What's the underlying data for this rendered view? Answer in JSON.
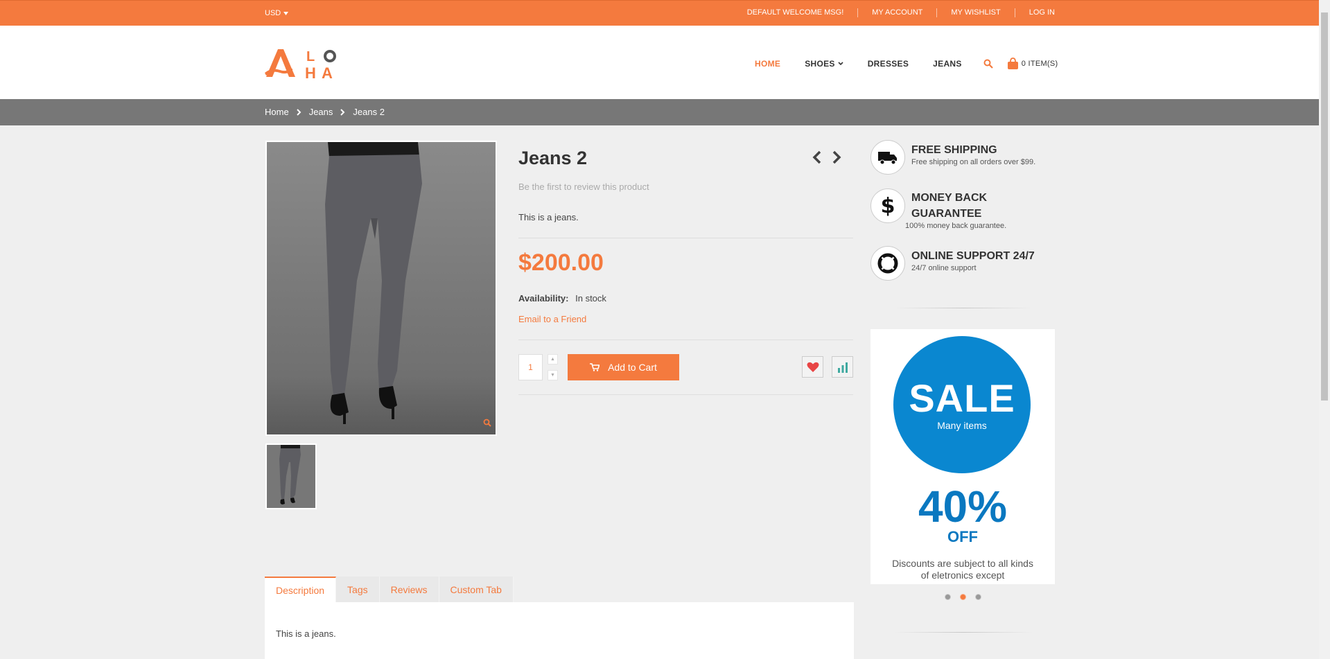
{
  "topbar": {
    "currency": "USD",
    "links": [
      "DEFAULT WELCOME MSG!",
      "MY ACCOUNT",
      "MY WISHLIST",
      "LOG IN"
    ]
  },
  "logo": {
    "letters": [
      "A",
      "L",
      "O",
      "H",
      "A"
    ],
    "alt": "ALOHA"
  },
  "nav": {
    "items": [
      "HOME",
      "SHOES",
      "DRESSES",
      "JEANS"
    ],
    "cart_label": "0 ITEM(S)"
  },
  "breadcrumb": [
    "Home",
    "Jeans",
    "Jeans 2"
  ],
  "product": {
    "name": "Jeans 2",
    "review_text": "Be the first to review this product",
    "short_description": "This is a jeans.",
    "price": "$200.00",
    "availability_label": "Availability:",
    "availability_value": "In stock",
    "email_link": "Email to a Friend",
    "qty": "1",
    "add_to_cart": "Add to Cart"
  },
  "features": [
    {
      "title": "FREE SHIPPING",
      "subtitle": "Free shipping on all orders over $99.",
      "icon": "truck-icon"
    },
    {
      "title": "MONEY BACK GUARANTEE",
      "subtitle": "100% money back guarantee.",
      "icon": "dollar-icon"
    },
    {
      "title": "ONLINE SUPPORT 24/7",
      "subtitle": "24/7 online support",
      "icon": "lifebuoy-icon"
    }
  ],
  "banner": {
    "sale": "SALE",
    "sale_sub": "Many items",
    "percent": "40%",
    "off": "OFF",
    "note": "Discounts are subject to all kinds of eletronics except"
  },
  "tabs": [
    "Description",
    "Tags",
    "Reviews",
    "Custom Tab"
  ],
  "tab_content": "This is a jeans.",
  "colors": {
    "accent": "#f47a3e",
    "breadcrumb_bg": "#777777",
    "banner_blue": "#0a87d0"
  }
}
